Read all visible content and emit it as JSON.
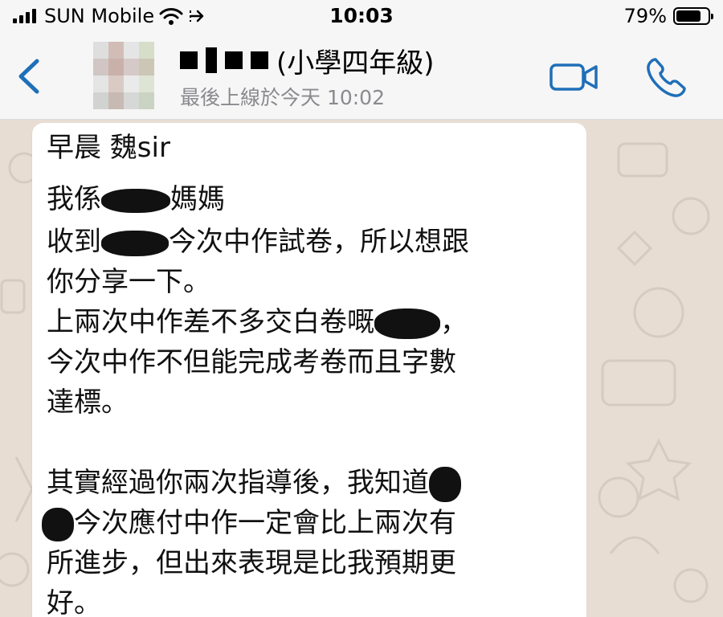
{
  "status_bar": {
    "carrier": "SUN Mobile",
    "time": "10:03",
    "battery_percent_text": "79%",
    "battery_level": 0.79
  },
  "header": {
    "contact_name_suffix": "(小學四年級)",
    "last_seen": "最後上線於今天 10:02",
    "icons": {
      "back": "chevron-left-icon",
      "video": "video-camera-icon",
      "call": "phone-icon"
    },
    "accent_color": "#1f6fb8"
  },
  "message": {
    "line1": "早晨 魏sir",
    "line2_prefix": "我係",
    "line2_suffix": "媽媽",
    "line3_prefix": "收到",
    "line3_suffix": "今次中作試卷，所以想跟",
    "line4": "你分享一下。",
    "line5_prefix": "上兩次中作差不多交白卷嘅",
    "line5_suffix": "，",
    "line6": "今次中作不但能完成考卷而且字數",
    "line7": "達標。",
    "line9_prefix": "其實經過你兩次指導後，我知道",
    "line10_suffix": "今次應付中作一定會比上兩次有",
    "line11": "所進步，但出來表現是比我預期更",
    "line12": "好。"
  },
  "colors": {
    "wallpaper": "#e7ddd3",
    "bubble": "#ffffff",
    "header_bg": "#f6f6f6"
  }
}
